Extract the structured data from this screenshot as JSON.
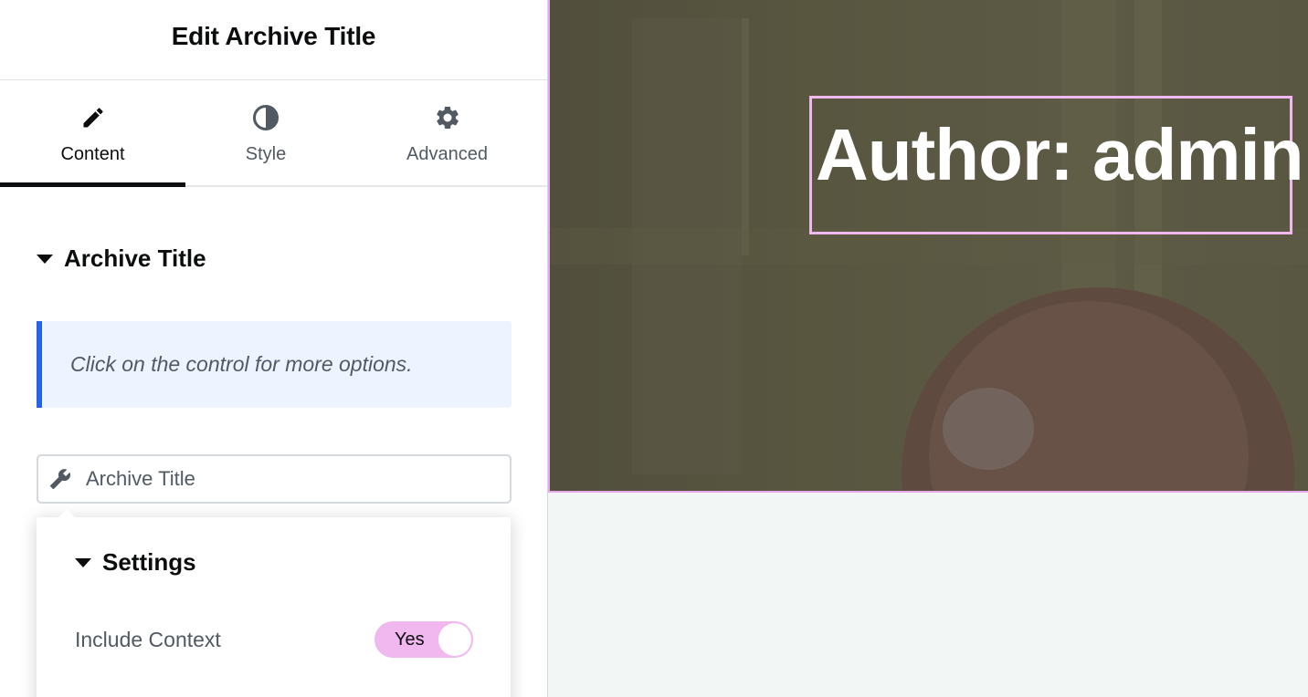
{
  "panel": {
    "title": "Edit Archive Title",
    "tabs": [
      {
        "label": "Content",
        "icon": "pencil-icon",
        "active": true
      },
      {
        "label": "Style",
        "icon": "contrast-icon",
        "active": false
      },
      {
        "label": "Advanced",
        "icon": "gear-icon",
        "active": false
      }
    ],
    "section_title": "Archive Title",
    "notice": "Click on the control for more options.",
    "control": {
      "icon": "wrench-icon",
      "label": "Archive Title"
    },
    "popover": {
      "section_title": "Settings",
      "include_context": {
        "label": "Include Context",
        "toggle_text": "Yes",
        "value": true
      }
    }
  },
  "preview": {
    "heading": "Author: admin"
  },
  "colors": {
    "accent_blue": "#2563eb",
    "toggle_pink": "#f1b8f0",
    "selection_border": "#f1b8f0",
    "hero_bg": "#58563f",
    "preview_bg": "#f2f7f5"
  }
}
